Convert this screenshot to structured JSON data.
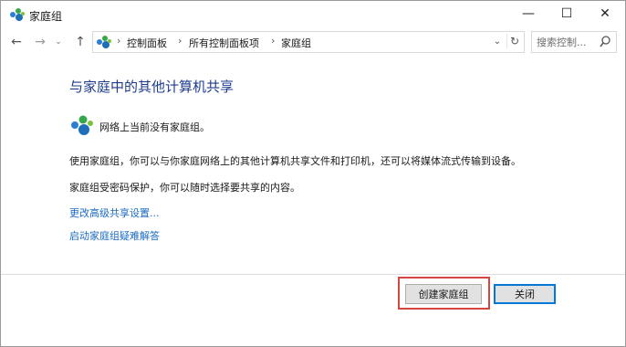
{
  "window": {
    "title": "家庭组",
    "controls": {
      "minimize": "—",
      "maximize": "☐",
      "close": "✕"
    }
  },
  "nav": {
    "back": "←",
    "forward": "→",
    "recent": "⌄",
    "up": "↑"
  },
  "address": {
    "separator": "›",
    "crumbs": [
      "控制面板",
      "所有控制面板项",
      "家庭组"
    ],
    "dropdown": "⌄",
    "refresh": "↻"
  },
  "search": {
    "placeholder": "搜索控制..."
  },
  "content": {
    "heading": "与家庭中的其他计算机共享",
    "status": "网络上当前没有家庭组。",
    "paragraphs": [
      "使用家庭组，你可以与你家庭网络上的其他计算机共享文件和打印机，还可以将媒体流式传输到设备。",
      "家庭组受密码保护，你可以随时选择要共享的内容。"
    ],
    "links": [
      "更改高级共享设置...",
      "启动家庭组疑难解答"
    ]
  },
  "footer": {
    "create_label": "创建家庭组",
    "close_label": "关闭"
  },
  "colors": {
    "heading": "#1e3c8c",
    "link": "#1a6bc4",
    "highlight": "#d64541",
    "focus": "#0078d7"
  },
  "icons": {
    "homegroup": "homegroup-icon",
    "search": "search-icon"
  }
}
